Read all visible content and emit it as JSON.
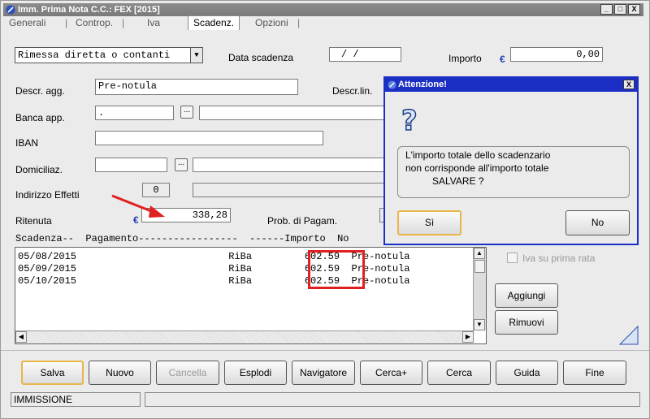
{
  "window": {
    "title": "Imm. Prima Nota C.C.: FEX  [2015]",
    "minimize": "_",
    "maximize": "□",
    "close": "X"
  },
  "tabs": [
    {
      "label": "Generali"
    },
    {
      "label": "Controp."
    },
    {
      "label": "Iva"
    },
    {
      "label": "Scadenz."
    },
    {
      "label": "Opzioni"
    }
  ],
  "tab_separator": "|",
  "form": {
    "payment_type": "Rimessa diretta o contanti",
    "data_scadenza_label": "Data scadenza",
    "data_scadenza_value": " /  /",
    "importo_label": "Importo",
    "currency_symbol": "€",
    "importo_value": "0,00",
    "descr_agg_label": "Descr. agg.",
    "descr_agg_value": "Pre-notula",
    "descr_lin_label": "Descr.lin.",
    "banca_app_label": "Banca app.",
    "banca_app_value": "   .",
    "lookup_button": "...",
    "iban_label": "IBAN",
    "domiciliaz_label": "Domiciliaz.",
    "indirizzo_label": "Indirizzo Effetti",
    "indirizzo_value": "0",
    "ritenuta_label": "Ritenuta",
    "ritenuta_value": "338,28",
    "prob_pagam_label": "Prob. di Pagam."
  },
  "list": {
    "header": "Scadenza--  Pagamento-----------------  ------Importo  No",
    "rows": [
      "05/08/2015                          RiBa         602.59  Pre-notula",
      "05/09/2015                          RiBa         602.59  Pre-notula",
      "05/10/2015                          RiBa         602.59  Pre-notula"
    ]
  },
  "side": {
    "iva_prima_rata_label": "Iva su prima rata",
    "aggiungi_label": "Aggiungi",
    "rimuovi_label": "Rimuovi"
  },
  "buttons": {
    "salva": "Salva",
    "nuovo": "Nuovo",
    "cancella": "Cancella",
    "esplodi": "Esplodi",
    "navigatore": "Navigatore",
    "cerca_plus": "Cerca+",
    "cerca": "Cerca",
    "guida": "Guida",
    "fine": "Fine"
  },
  "status": {
    "mode": "IMMISSIONE"
  },
  "dialog": {
    "title": "Attenzione!",
    "close": "X",
    "icon_glyph": "?",
    "message_line1": "L'importo totale dello scadenzario",
    "message_line2": "non corrisponde all'importo totale",
    "message_line3": "SALVARE ?",
    "yes_label": "Sì",
    "no_label": "No"
  },
  "colors": {
    "dialog_border": "#1c2fc4",
    "annotation_red": "#e02020",
    "euro_blue": "#1f3fb4"
  },
  "icons": [
    "app-icon",
    "question-icon",
    "red-arrow-annotation"
  ]
}
